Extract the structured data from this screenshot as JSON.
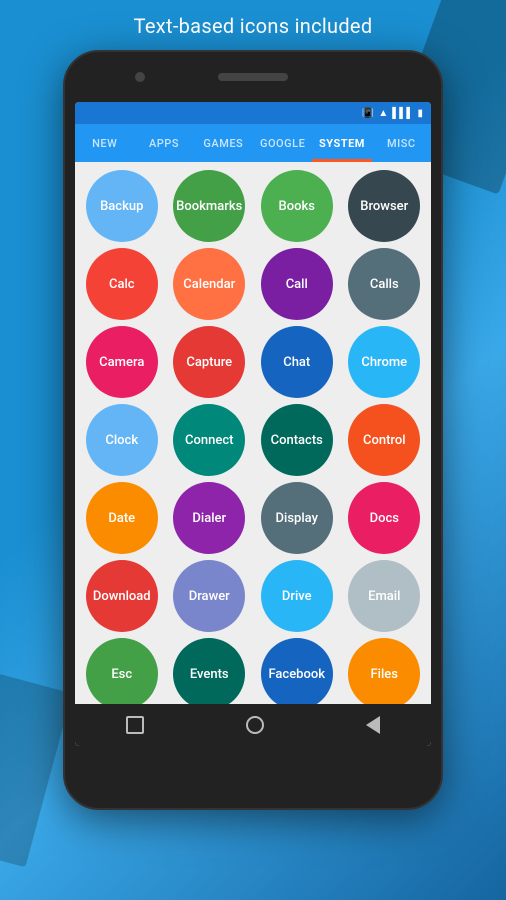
{
  "header": {
    "title": "Text-based icons included"
  },
  "tabs": [
    {
      "label": "NEW",
      "active": false
    },
    {
      "label": "APPS",
      "active": false
    },
    {
      "label": "GAMES",
      "active": false
    },
    {
      "label": "GOOGLE",
      "active": false
    },
    {
      "label": "SYSTEM",
      "active": true
    },
    {
      "label": "MISC",
      "active": false
    }
  ],
  "status_bar": {
    "icons": [
      "📳",
      "📶",
      "📶",
      "🔋"
    ]
  },
  "icons": [
    {
      "label": "Backup",
      "color": "#64b5f6"
    },
    {
      "label": "Bookmarks",
      "color": "#43a047"
    },
    {
      "label": "Books",
      "color": "#4caf50"
    },
    {
      "label": "Browser",
      "color": "#37474f"
    },
    {
      "label": "Calc",
      "color": "#f44336"
    },
    {
      "label": "Calendar",
      "color": "#ff7043"
    },
    {
      "label": "Call",
      "color": "#7b1fa2"
    },
    {
      "label": "Calls",
      "color": "#546e7a"
    },
    {
      "label": "Camera",
      "color": "#e91e63"
    },
    {
      "label": "Capture",
      "color": "#e53935"
    },
    {
      "label": "Chat",
      "color": "#1565c0"
    },
    {
      "label": "Chrome",
      "color": "#29b6f6"
    },
    {
      "label": "Clock",
      "color": "#64b5f6"
    },
    {
      "label": "Connect",
      "color": "#00897b"
    },
    {
      "label": "Contacts",
      "color": "#00695c"
    },
    {
      "label": "Control",
      "color": "#f4511e"
    },
    {
      "label": "Date",
      "color": "#fb8c00"
    },
    {
      "label": "Dialer",
      "color": "#8e24aa"
    },
    {
      "label": "Display",
      "color": "#546e7a"
    },
    {
      "label": "Docs",
      "color": "#e91e63"
    },
    {
      "label": "Download",
      "color": "#e53935"
    },
    {
      "label": "Drawer",
      "color": "#7986cb"
    },
    {
      "label": "Drive",
      "color": "#29b6f6"
    },
    {
      "label": "Email",
      "color": "#b0bec5"
    },
    {
      "label": "Esc",
      "color": "#43a047"
    },
    {
      "label": "Events",
      "color": "#00695c"
    },
    {
      "label": "Facebook",
      "color": "#1565c0"
    },
    {
      "label": "Files",
      "color": "#fb8c00"
    }
  ],
  "bottom_nav": {
    "square_label": "recent-apps",
    "circle_label": "home",
    "back_label": "back"
  }
}
